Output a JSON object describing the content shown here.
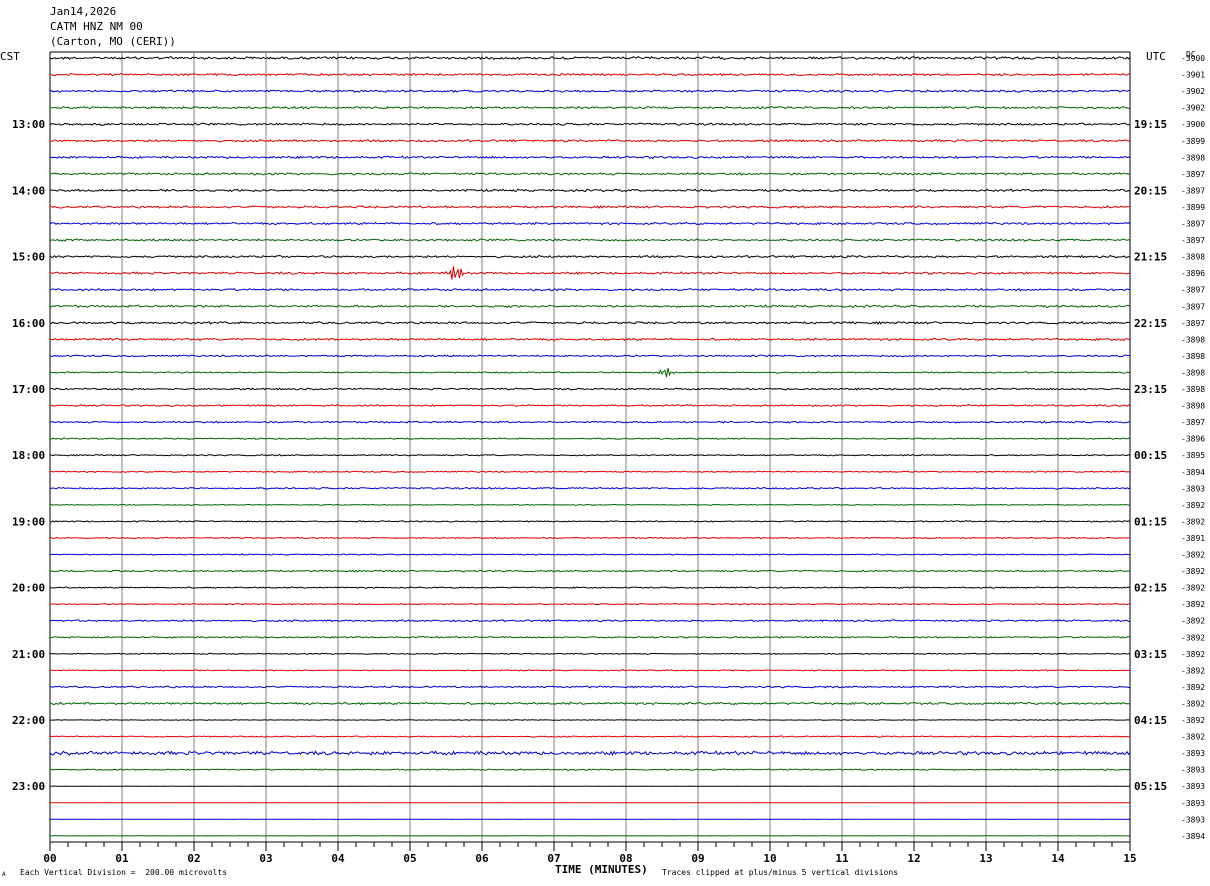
{
  "header": {
    "date": "Jan14,2026",
    "station": "CATM HNZ NM 00",
    "location": "(Carton, MO (CERI))"
  },
  "left_axis_label": "CST",
  "right_axis_label": "UTC",
  "dc_label": "DC",
  "footer": {
    "scale_note": "Each Vertical Division =  200.00 microvolts",
    "x_axis_title": "TIME (MINUTES)",
    "clip_note": "Traces clipped at plus/minus 5 vertical divisions",
    "corner_mark": "A"
  },
  "colors": {
    "black": "#000000",
    "red": "#e00000",
    "blue": "#0000d0",
    "green": "#006400",
    "grid": "#808080"
  },
  "chart_data": {
    "type": "line",
    "title": "CATM HNZ NM 00",
    "xlabel": "TIME (MINUTES)",
    "xlim": [
      0,
      15
    ],
    "x_ticks": [
      "00",
      "01",
      "02",
      "03",
      "04",
      "05",
      "06",
      "07",
      "08",
      "09",
      "10",
      "11",
      "12",
      "13",
      "14",
      "15"
    ],
    "trace_colors_cycle": [
      "black",
      "red",
      "blue",
      "green"
    ],
    "left_time_labels": [
      "13:00",
      "14:00",
      "15:00",
      "16:00",
      "17:00",
      "18:00",
      "19:00",
      "20:00",
      "21:00",
      "22:00",
      "23:00"
    ],
    "right_time_labels": [
      "19:15",
      "20:15",
      "21:15",
      "22:15",
      "23:15",
      "00:15",
      "01:15",
      "02:15",
      "03:15",
      "04:15",
      "05:15"
    ],
    "label_every_n_traces": 4,
    "first_labeled_trace": 4,
    "dc_offsets": [
      "-3900",
      "-3901",
      "-3902",
      "-3902",
      "-3900",
      "-3899",
      "-3898",
      "-3897",
      "-3897",
      "-3899",
      "-3897",
      "-3897",
      "-3898",
      "-3896",
      "-3897",
      "-3897",
      "-3897",
      "-3898",
      "-3898",
      "-3898",
      "-3898",
      "-3898",
      "-3897",
      "-3896",
      "-3895",
      "-3894",
      "-3893",
      "-3892",
      "-3892",
      "-3891",
      "-3892",
      "-3892",
      "-3892",
      "-3892",
      "-3892",
      "-3892",
      "-3892",
      "-3892",
      "-3892",
      "-3892",
      "-3892",
      "-3892",
      "-3893",
      "-3893",
      "-3893",
      "-3893",
      "-3893",
      "-3894"
    ],
    "trace_count": 48,
    "trace_noise_level": [
      0.6,
      0.5,
      0.5,
      0.5,
      0.5,
      0.5,
      0.5,
      0.5,
      0.5,
      0.5,
      0.5,
      0.5,
      0.5,
      0.5,
      0.5,
      0.5,
      0.5,
      0.5,
      0.4,
      0.3,
      0.4,
      0.4,
      0.4,
      0.3,
      0.3,
      0.3,
      0.4,
      0.2,
      0.3,
      0.3,
      0.25,
      0.35,
      0.3,
      0.25,
      0.4,
      0.35,
      0.25,
      0.25,
      0.4,
      0.5,
      0.15,
      0.3,
      0.8,
      0.3,
      0.05,
      0.05,
      0.05,
      0.05
    ],
    "events": [
      {
        "trace": 13,
        "minute": 5.63,
        "amplitude": 1.4
      },
      {
        "trace": 19,
        "minute": 8.56,
        "amplitude": 0.8
      }
    ]
  }
}
